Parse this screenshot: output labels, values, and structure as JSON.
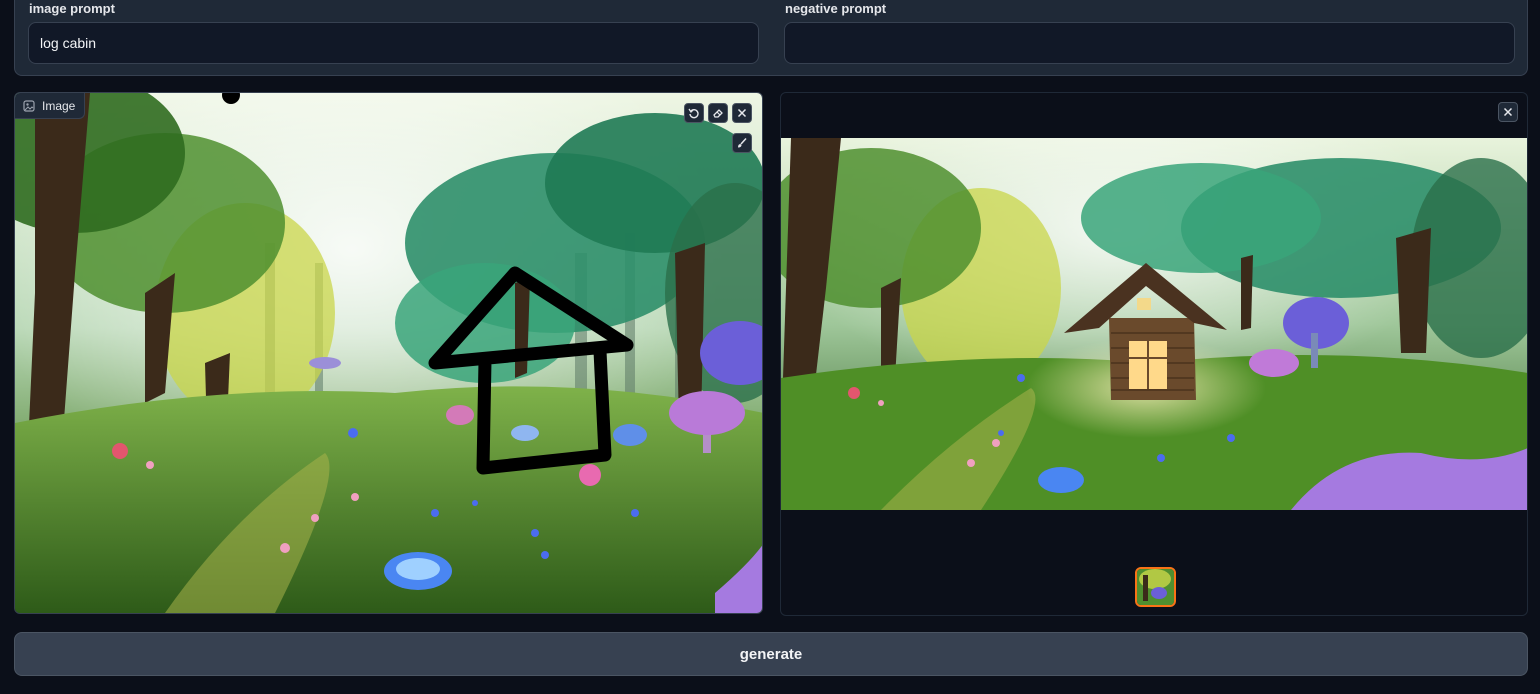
{
  "prompts": {
    "image_prompt_label": "image prompt",
    "image_prompt_value": "log cabin",
    "negative_prompt_label": "negative prompt",
    "negative_prompt_value": ""
  },
  "input_image": {
    "badge_label": "Image",
    "badge_icon": "image-icon",
    "tools": [
      "undo-icon",
      "eraser-icon",
      "close-icon",
      "brush-icon"
    ]
  },
  "output_gallery": {
    "tools": [
      "close-icon"
    ],
    "thumbnail_selected": true
  },
  "actions": {
    "generate_label": "generate"
  },
  "colors": {
    "background": "#0b0f19",
    "panel": "#1f2937",
    "border": "#374151",
    "accent_selected": "#f97316",
    "button": "#374151"
  }
}
